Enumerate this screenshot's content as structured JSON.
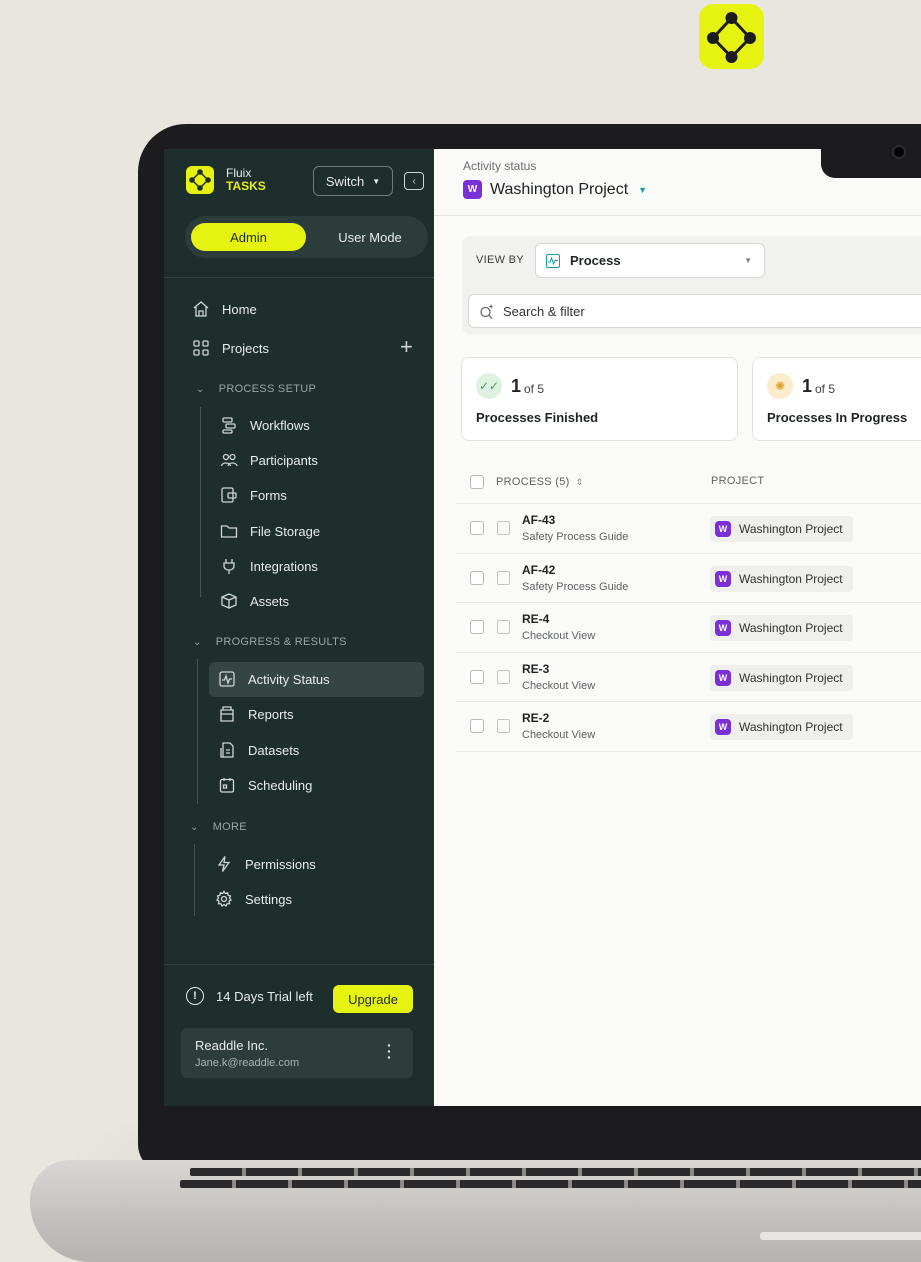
{
  "brand": {
    "line1": "Fluix",
    "line2": "TASKS"
  },
  "header": {
    "switch_label": "Switch",
    "mode_admin": "Admin",
    "mode_user": "User Mode"
  },
  "sidebar": {
    "home": "Home",
    "projects": "Projects",
    "process_setup_heading": "PROCESS SETUP",
    "process_setup_items": [
      "Workflows",
      "Participants",
      "Forms",
      "File Storage",
      "Integrations",
      "Assets"
    ],
    "progress_heading": "PROGRESS & RESULTS",
    "progress_items": [
      "Activity Status",
      "Reports",
      "Datasets",
      "Scheduling"
    ],
    "more_heading": "MORE",
    "more_items": [
      "Permissions",
      "Settings"
    ],
    "trial_text": "14 Days Trial left",
    "upgrade_label": "Upgrade",
    "account_name": "Readdle Inc.",
    "account_email": "Jane.k@readdle.com"
  },
  "main": {
    "crumb": "Activity status",
    "project_badge": "W",
    "project_title": "Washington Project",
    "viewby_label": "VIEW BY",
    "viewby_value": "Process",
    "search_placeholder": "Search & filter",
    "stats": [
      {
        "count": "1",
        "of": "of 5",
        "label": "Processes Finished"
      },
      {
        "count": "1",
        "of": "of 5",
        "label": "Processes In Progress"
      }
    ],
    "table": {
      "col_process": "PROCESS (5)",
      "col_project": "PROJECT",
      "rows": [
        {
          "code": "AF-43",
          "sub": "Safety Process Guide",
          "project": "Washington Project",
          "badge": "W"
        },
        {
          "code": "AF-42",
          "sub": "Safety Process Guide",
          "project": "Washington Project",
          "badge": "W"
        },
        {
          "code": "RE-4",
          "sub": "Checkout View",
          "project": "Washington Project",
          "badge": "W"
        },
        {
          "code": "RE-3",
          "sub": "Checkout View",
          "project": "Washington Project",
          "badge": "W"
        },
        {
          "code": "RE-2",
          "sub": "Checkout View",
          "project": "Washington Project",
          "badge": "W"
        }
      ]
    }
  },
  "colors": {
    "accent": "#e6f20f",
    "sidebar_bg": "#1e2e2d",
    "project_badge": "#7b2fd6"
  }
}
